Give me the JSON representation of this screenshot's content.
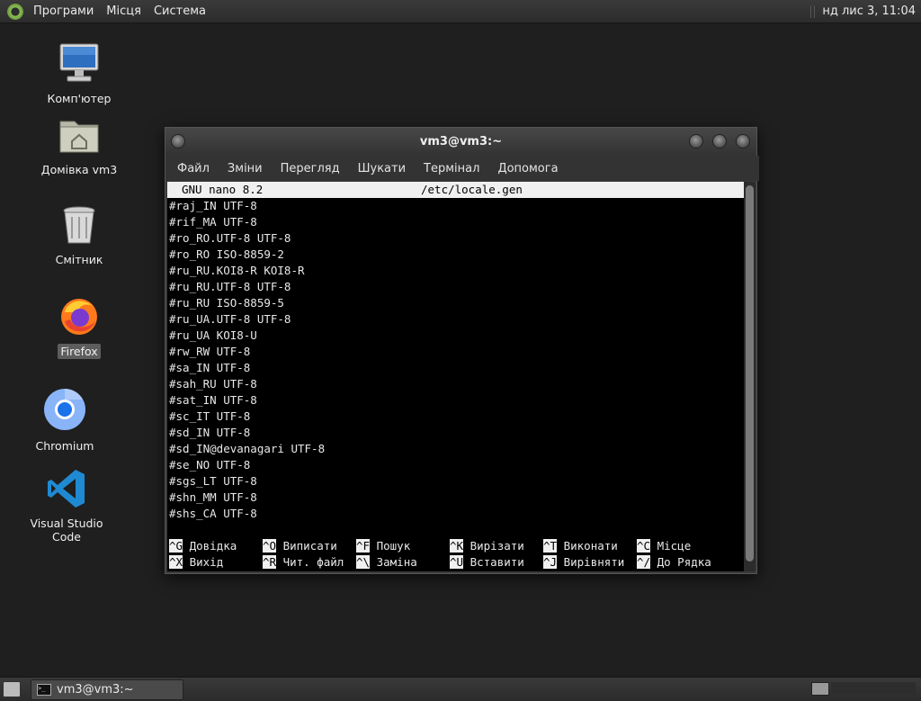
{
  "top_panel": {
    "menus": [
      "Програми",
      "Місця",
      "Система"
    ],
    "clock": "нд лис 3, 11:04"
  },
  "desktop_icons": [
    {
      "label": "Комп'ютер",
      "icon": "computer-icon"
    },
    {
      "label": "Домівка vm3",
      "icon": "home-folder-icon"
    },
    {
      "label": "Смітник",
      "icon": "trash-icon"
    },
    {
      "label": "Firefox",
      "icon": "firefox-icon",
      "selected": true
    },
    {
      "label": "Chromium",
      "icon": "chromium-icon"
    },
    {
      "label": "Visual Studio Code",
      "icon": "vscode-icon"
    }
  ],
  "window": {
    "title": "vm3@vm3:~",
    "menu": [
      "Файл",
      "Зміни",
      "Перегляд",
      "Шукати",
      "Термінал",
      "Допомога"
    ]
  },
  "nano": {
    "version": "GNU nano 8.2",
    "filename": "/etc/locale.gen",
    "lines": [
      "#raj_IN UTF-8",
      "#rif_MA UTF-8",
      "#ro_RO.UTF-8 UTF-8",
      "#ro_RO ISO-8859-2",
      "#ru_RU.KOI8-R KOI8-R",
      "#ru_RU.UTF-8 UTF-8",
      "#ru_RU ISO-8859-5",
      "#ru_UA.UTF-8 UTF-8",
      "#ru_UA KOI8-U",
      "#rw_RW UTF-8",
      "#sa_IN UTF-8",
      "#sah_RU UTF-8",
      "#sat_IN UTF-8",
      "#sc_IT UTF-8",
      "#sd_IN UTF-8",
      "#sd_IN@devanagari UTF-8",
      "#se_NO UTF-8",
      "#sgs_LT UTF-8",
      "#shn_MM UTF-8",
      "#shs_CA UTF-8"
    ],
    "shortcuts_row1": [
      {
        "key": "^G",
        "label": "Довідка"
      },
      {
        "key": "^O",
        "label": "Виписати"
      },
      {
        "key": "^F",
        "label": "Пошук"
      },
      {
        "key": "^K",
        "label": "Вирізати"
      },
      {
        "key": "^T",
        "label": "Виконати"
      },
      {
        "key": "^C",
        "label": "Місце"
      }
    ],
    "shortcuts_row2": [
      {
        "key": "^X",
        "label": "Вихід"
      },
      {
        "key": "^R",
        "label": "Чит. файл"
      },
      {
        "key": "^\\",
        "label": "Заміна"
      },
      {
        "key": "^U",
        "label": "Вставити"
      },
      {
        "key": "^J",
        "label": "Вирівняти"
      },
      {
        "key": "^/",
        "label": "До Рядка"
      }
    ]
  },
  "taskbar": {
    "task_label": "vm3@vm3:~"
  }
}
